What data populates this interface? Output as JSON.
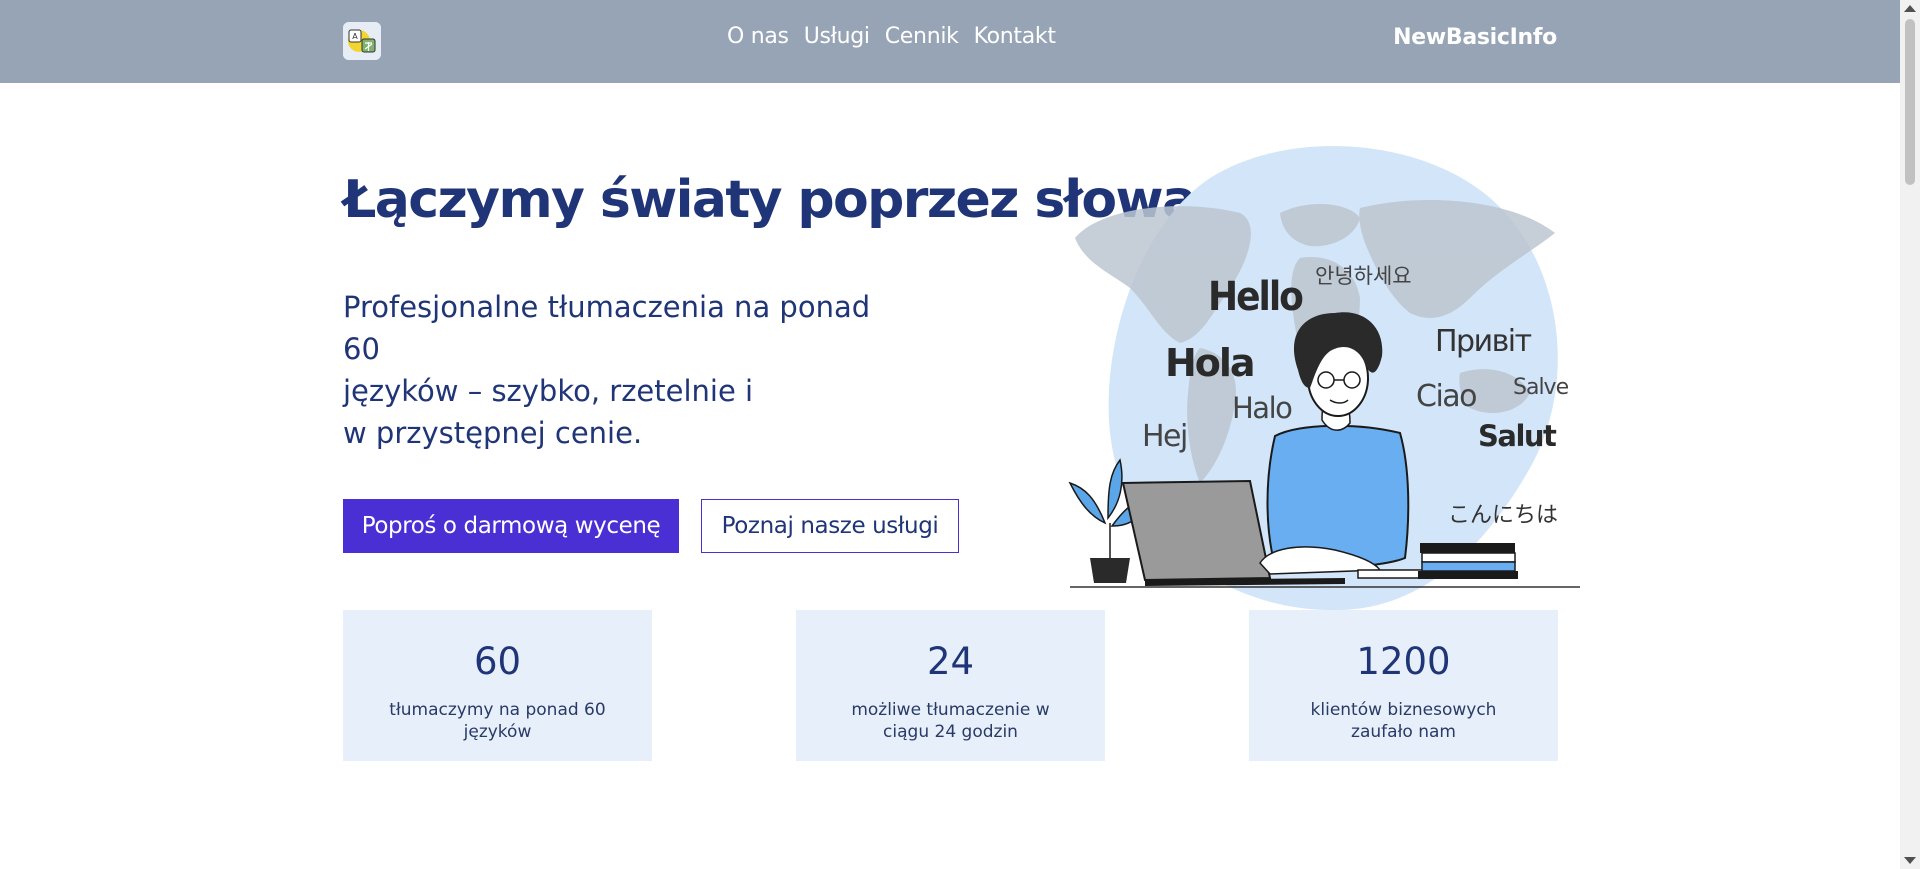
{
  "nav": {
    "links": [
      "O nas",
      "Usługi",
      "Cennik",
      "Kontakt"
    ],
    "brand": "NewBasicInfo"
  },
  "hero": {
    "title": "Łączymy światy poprzez słowa",
    "subtitle_lines": [
      "Profesjonalne tłumaczenia na ponad",
      "60",
      "języków – szybko, rzetelnie i",
      "w przystępnej cenie."
    ],
    "primary_button": "Poproś o darmową wycenę",
    "secondary_button": "Poznaj nasze usługi"
  },
  "illustration": {
    "greetings": [
      "안녕하세요",
      "Hello",
      "Hola",
      "Привіт",
      "Halo",
      "Ciao",
      "Salve",
      "Hej",
      "Salut",
      "こんにちは"
    ]
  },
  "stats": [
    {
      "number": "60",
      "label": "tłumaczymy na ponad 60 języków"
    },
    {
      "number": "24",
      "label": "możliwe tłumaczenie w ciągu 24 godzin"
    },
    {
      "number": "1200",
      "label": "klientów biznesowych zaufało nam"
    }
  ],
  "colors": {
    "navbar": "#97a4b5",
    "primary": "#4a2fd4",
    "text": "#1f3577",
    "stat_bg": "#e7f0fa"
  }
}
